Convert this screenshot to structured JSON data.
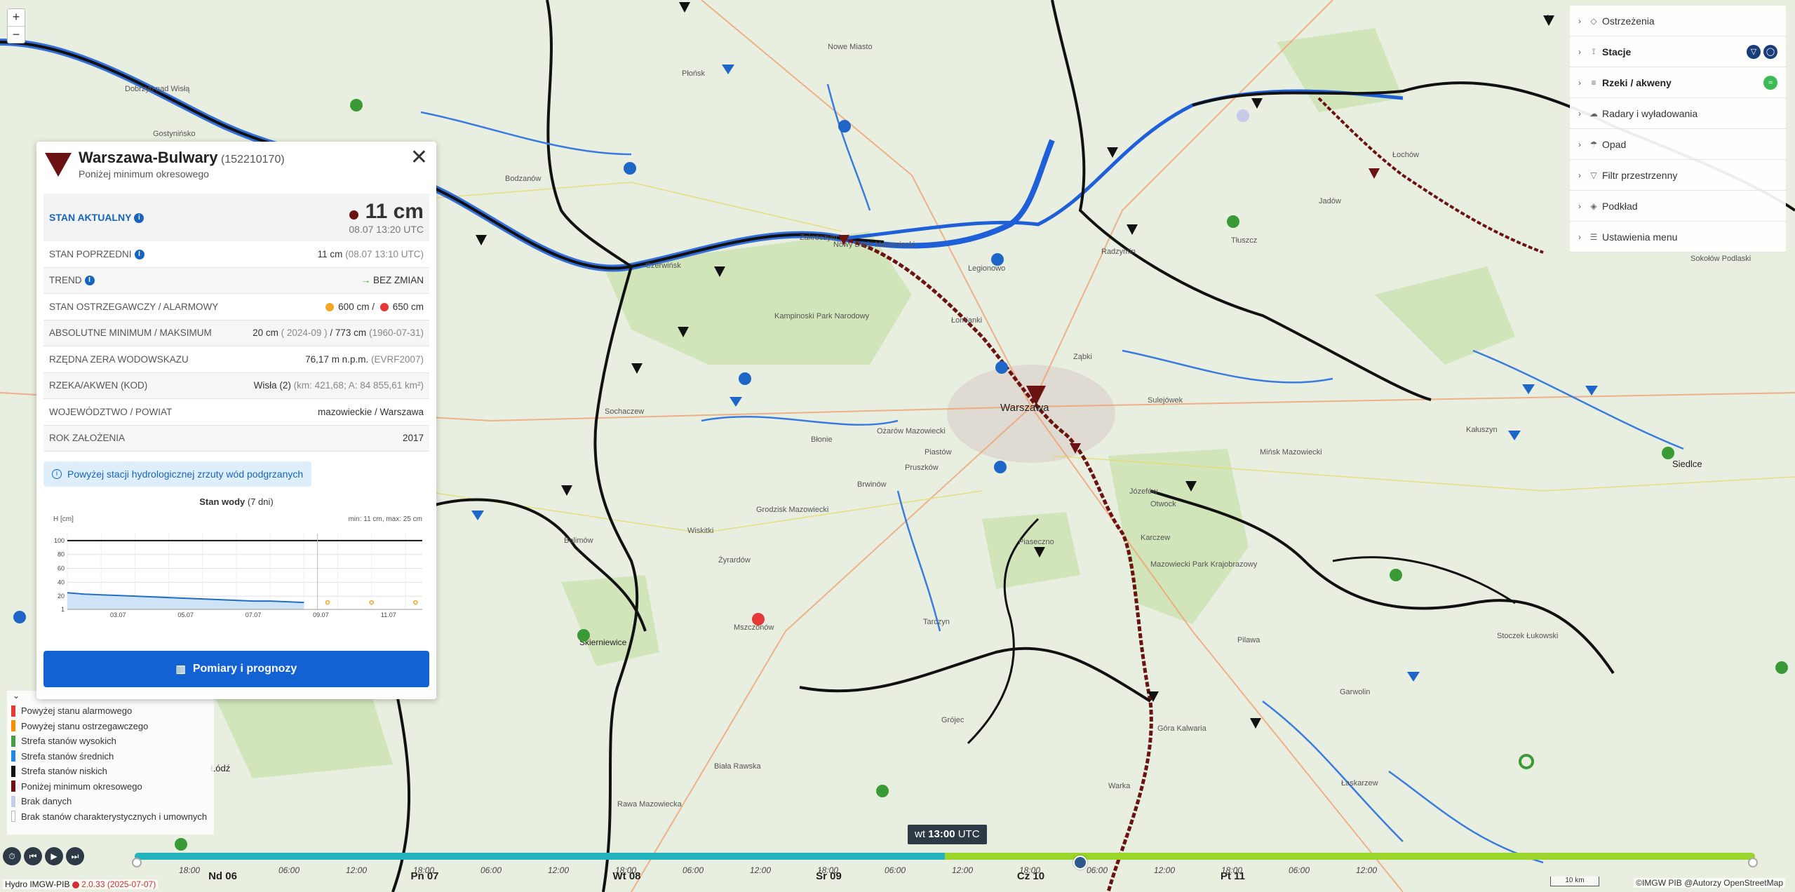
{
  "map": {
    "places": [
      "Płońsk",
      "Nowe Miasto",
      "Dobrzyń nad Wisłą",
      "Gostynińsko",
      "Bodzanów",
      "Czerwińsk",
      "Zakroczym",
      "Nowy Dwór Mazowiecki",
      "Legionowo",
      "Radzymin",
      "Tłuszcz",
      "Łochów",
      "Kampinoski Park Narodowy",
      "Łomianki",
      "Sochaczew",
      "Błonie",
      "Ożarów Mazowiecki",
      "Warszawa",
      "Ząbki",
      "Sulejówek",
      "Mińsk Mazowiecki",
      "Kałuszyn",
      "Siedlce",
      "Pruszków",
      "Piastów",
      "Brwinów",
      "Grodzisk Mazowiecki",
      "Piaseczno",
      "Józefów",
      "Otwock",
      "Karczew",
      "Mazowiecki Park Krajobrazowy",
      "Żyrardów",
      "Wiskitki",
      "Mszczonów",
      "Skierniewice",
      "Bolimów",
      "Tarczyn",
      "Grójec",
      "Pilawa",
      "Garwolin",
      "Łaskarzew",
      "Rawa Mazowiecka",
      "Biała Rawska",
      "Łódź",
      "Stoczek Łukowski",
      "Sokołów Podlaski",
      "Jadów",
      "Warka",
      "Góra Kalwaria"
    ]
  },
  "zoom": {
    "in": "+",
    "out": "−"
  },
  "menu": {
    "collapse": "›",
    "items": [
      {
        "label": "Ostrzeżenia",
        "icon": "◇"
      },
      {
        "label": "Stacje",
        "icon": "⟟"
      },
      {
        "label": "Rzeki / akweny",
        "icon": "≡"
      },
      {
        "label": "Radary i wyładowania",
        "icon": "☁"
      },
      {
        "label": "Opad",
        "icon": "☂"
      },
      {
        "label": "Filtr przestrzenny",
        "icon": "▽"
      },
      {
        "label": "Podkład",
        "icon": "◈"
      },
      {
        "label": "Ustawienia menu",
        "icon": "☰"
      }
    ]
  },
  "station": {
    "name": "Warszawa-Bulwary",
    "code": "(152210170)",
    "subtitle": "Poniżej minimum okresowego",
    "close": "✕",
    "current_label": "STAN AKTUALNY",
    "current_value": "11 cm",
    "current_time": "08.07 13:20 UTC",
    "info": "i",
    "rows": [
      {
        "k": "STAN POPRZEDNI",
        "v": "11 cm",
        "m": "(08.07 13:10 UTC)",
        "info": true
      },
      {
        "k": "TREND",
        "v": "BEZ ZMIAN",
        "arrow": "→",
        "info": true
      },
      {
        "k": "STAN OSTRZEGAWCZY / ALARMOWY",
        "warn": "600 cm",
        "alarm": "650 cm"
      },
      {
        "k": "ABSOLUTNE MINIMUM / MAKSIMUM",
        "min": "20 cm",
        "min_date": "( 2024-09 )",
        "max": "773 cm",
        "max_date": "(1960-07-31)"
      },
      {
        "k": "RZĘDNA ZERA WODOWSKAZU",
        "v": "76,17 m n.p.m.",
        "m": "(EVRF2007)"
      },
      {
        "k": "RZEKA/AKWEN (KOD)",
        "v": "Wisła (2)",
        "m": "(km: 421,68; A: 84 855,61 km²)"
      },
      {
        "k": "WOJEWÓDZTWO / POWIAT",
        "v": "mazowieckie / Warszawa"
      },
      {
        "k": "ROK ZAŁOŻENIA",
        "v": "2017"
      }
    ],
    "notice": "Powyżej stacji hydrologicznej zrzuty wód podgrzanych",
    "notice_icon": "i",
    "chart_title": "Stan wody",
    "chart_title_suffix": "(7 dni)",
    "chart_ylabel": "H [cm]",
    "chart_minmax": "min: 11 cm, max: 25 cm",
    "button": "Pomiary i prognozy",
    "button_icon": "▥"
  },
  "chart_data": {
    "type": "line",
    "title": "Stan wody (7 dni)",
    "ylabel": "H [cm]",
    "xlabel": "",
    "x_ticks": [
      "03.07",
      "05.07",
      "07.07",
      "09.07",
      "11.07"
    ],
    "y_ticks": [
      1,
      20,
      40,
      60,
      80,
      100
    ],
    "ylim": [
      1,
      110
    ],
    "grid": true,
    "series": [
      {
        "kind": "observed",
        "x": [
          0,
          0.5,
          1,
          1.5,
          2,
          2.5,
          3,
          3.5,
          4,
          4.5,
          5,
          5.5,
          6,
          6.5,
          7
        ],
        "values": [
          25,
          23,
          22,
          21,
          20,
          19,
          18,
          17,
          16,
          15,
          14,
          13,
          13,
          12,
          11
        ]
      },
      {
        "kind": "forecast",
        "x": [
          7.7,
          9,
          10.3
        ],
        "values": [
          11,
          11,
          11
        ]
      },
      {
        "kind": "level",
        "values": [
          100,
          100
        ]
      }
    ]
  },
  "legend": {
    "toggle": "⌄",
    "items": [
      {
        "label": "Powyżej stanu alarmowego",
        "color": "#e53935"
      },
      {
        "label": "Powyżej stanu ostrzegawczego",
        "color": "#fb8c00"
      },
      {
        "label": "Strefa stanów wysokich",
        "color": "#43a047"
      },
      {
        "label": "Strefa stanów średnich",
        "color": "#1e88e5"
      },
      {
        "label": "Strefa stanów niskich",
        "color": "#111111"
      },
      {
        "label": "Poniżej minimum okresowego",
        "color": "#6b1212"
      },
      {
        "label": "Brak danych",
        "color": "#c5cbe8"
      },
      {
        "label": "Brak stanów charakterystycznych i umownych",
        "color": "#ffffff"
      }
    ]
  },
  "timeline": {
    "tooltip_day": "wt",
    "tooltip_time": "13:00",
    "tooltip_tz": "UTC",
    "controls": [
      "⏱",
      "⏮",
      "▶",
      "⏭"
    ],
    "days": [
      "Nd 06",
      "Pn 07",
      "Wt 08",
      "Śr 09",
      "Cz 10",
      "Pt 11"
    ],
    "hours": [
      "18:00",
      "06:00",
      "12:00",
      "18:00",
      "06:00",
      "12:00",
      "18:00",
      "06:00",
      "12:00",
      "18:00",
      "06:00",
      "12:00",
      "18:00",
      "06:00",
      "12:00",
      "18:00",
      "06:00",
      "12:00"
    ]
  },
  "footer": {
    "app": "Hydro IMGW-PIB",
    "version": "2.0.33 (2025-07-07)",
    "scale": "10 km",
    "attribution": "©IMGW PIB @Autorzy OpenStreetMap"
  },
  "colors": {
    "accent": "#1262d4",
    "below_min": "#6b1212",
    "timeline_past": "#22b3bf",
    "timeline_future": "#9bd42a"
  }
}
